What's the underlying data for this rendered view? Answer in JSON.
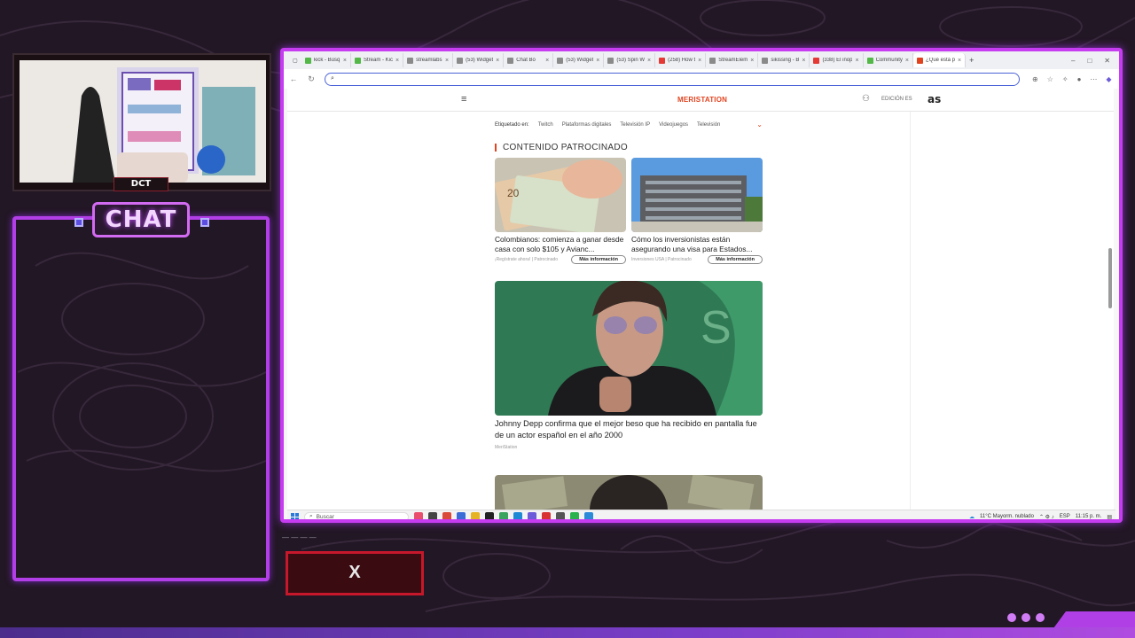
{
  "overlay": {
    "chat_title": "CHAT",
    "cam_logo": "DCT",
    "social_label": "X",
    "accent_color": "#c63cf0"
  },
  "browser": {
    "tabs": [
      {
        "title": "kick - Búsq",
        "color": "#53b848"
      },
      {
        "title": "Stream - Kic",
        "color": "#53b848"
      },
      {
        "title": "streamlabs",
        "color": "#8a8a8a"
      },
      {
        "title": "(53) Widget",
        "color": "#8a8a8a"
      },
      {
        "title": "Chat Bo",
        "color": "#8a8a8a"
      },
      {
        "title": "(53) Widget",
        "color": "#8a8a8a"
      },
      {
        "title": "(53) Spin W",
        "color": "#8a8a8a"
      },
      {
        "title": "(258) How t",
        "color": "#e53935"
      },
      {
        "title": "StreamElem",
        "color": "#8a8a8a"
      },
      {
        "title": "sikissing - B",
        "color": "#8a8a8a"
      },
      {
        "title": "(338) El inop",
        "color": "#e53935"
      },
      {
        "title": "Community",
        "color": "#53b848"
      },
      {
        "title": "¿Qué está p",
        "color": "#e2431f"
      }
    ],
    "new_tab": "+",
    "address_value": "",
    "window_controls": [
      "–",
      "□",
      "✕"
    ]
  },
  "site": {
    "logo": "MERISTATION",
    "edition": "EDICIÓN ES",
    "partner_logo": "as",
    "tagged_label": "Etiquetado en:",
    "tags": [
      "Twitch",
      "Plataformas digitales",
      "Televisión IP",
      "Videojuegos",
      "Televisión"
    ],
    "section_title": "CONTENIDO PATROCINADO",
    "sponsored": [
      {
        "headline": "Colombianos: comienza a ganar desde casa con solo $105 y Avianc...",
        "source": "¡Regístrate ahora! | Patrocinado",
        "button": "Más información"
      },
      {
        "headline": "Cómo los inversionistas están asegurando una visa para Estados...",
        "source": "Inversiones USA | Patrocinado",
        "button": "Más información"
      }
    ],
    "featured": {
      "headline": "Johnny Depp confirma que el mejor beso que ha recibido en pantalla fue de un actor español en el año 2000",
      "source": "MeriStation"
    }
  },
  "taskbar": {
    "search_placeholder": "Buscar",
    "weather": "11°C  Mayorm. nublado",
    "lang": "ESP",
    "time": "11:15 p. m."
  }
}
